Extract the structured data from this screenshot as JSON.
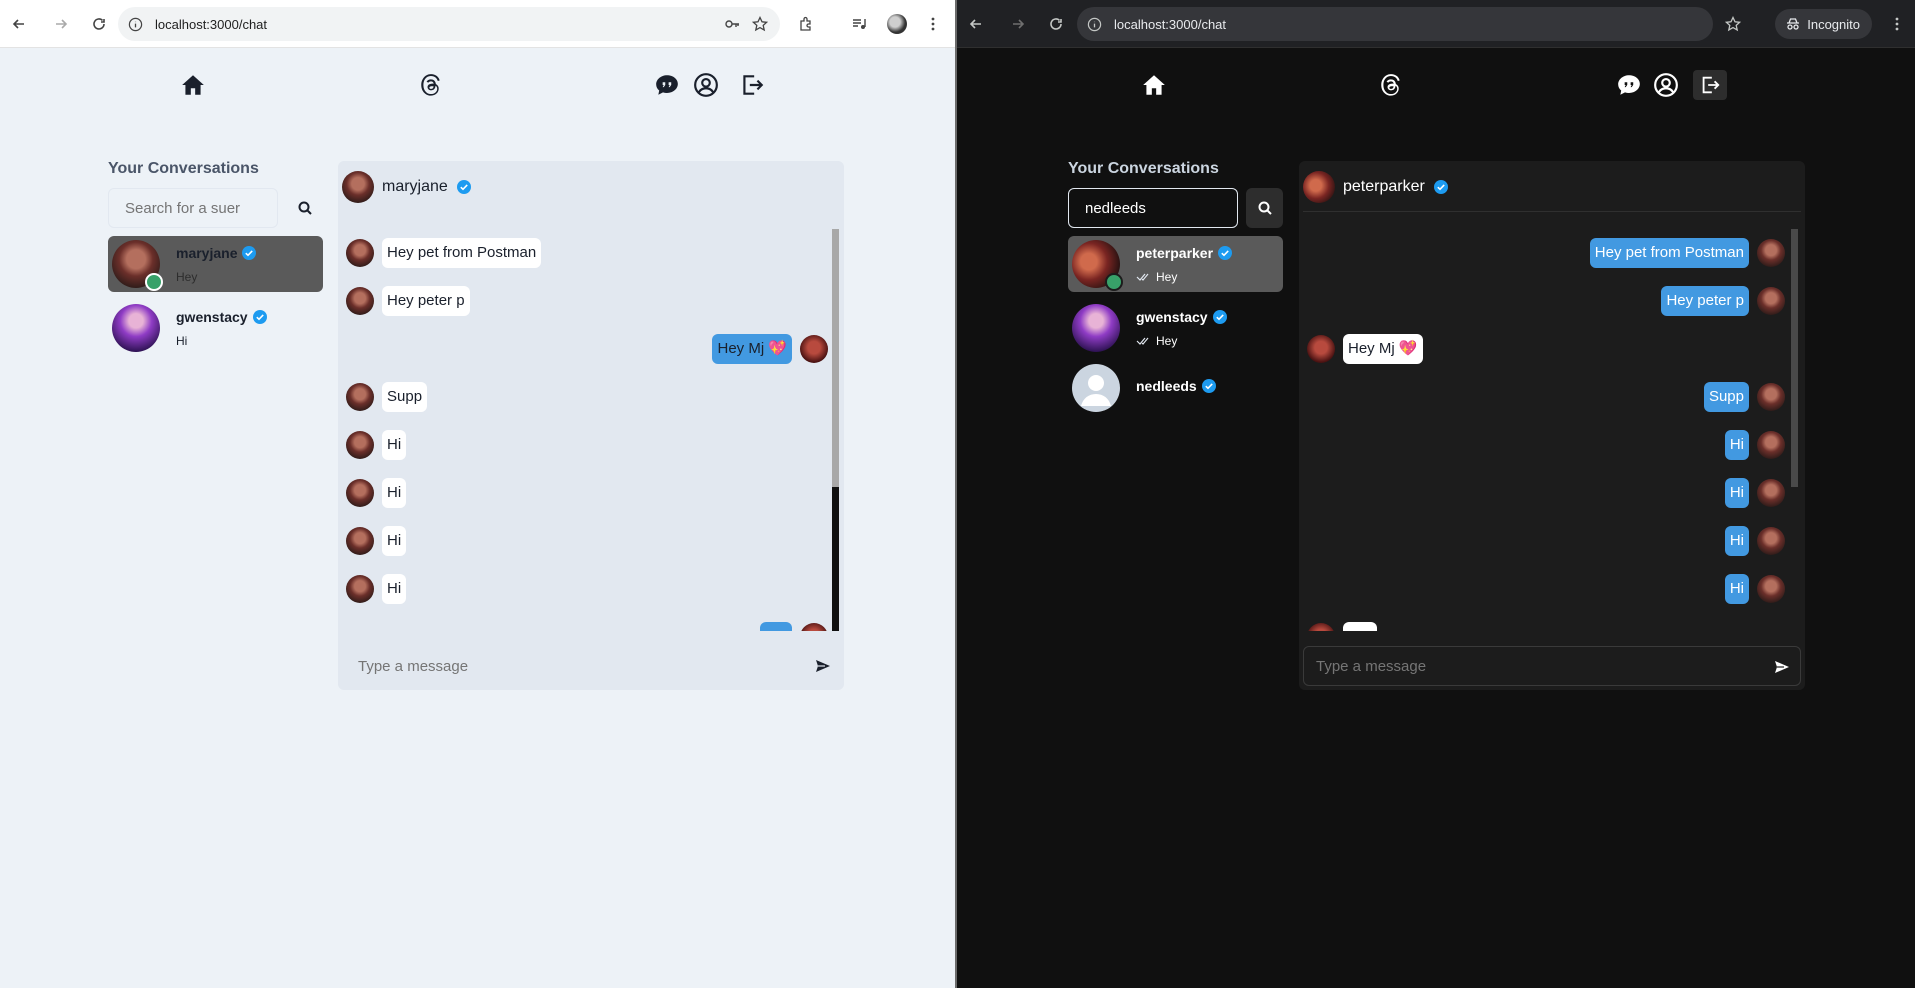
{
  "light": {
    "url": "localhost:3000/chat",
    "sidebar_title": "Your Conversations",
    "search_placeholder": "Search for a suer",
    "search_value": "",
    "conversations": [
      {
        "name": "maryjane",
        "last": "Hey",
        "online": true,
        "selected": true,
        "seen": false
      },
      {
        "name": "gwenstacy",
        "last": "Hi",
        "online": false,
        "selected": false,
        "seen": false
      }
    ],
    "chat_user": "maryjane",
    "messages": [
      {
        "text": "Hey pet from Postman",
        "mine": false
      },
      {
        "text": "Hey peter p",
        "mine": false
      },
      {
        "text": "Hey Mj 💖",
        "mine": true
      },
      {
        "text": "Supp",
        "mine": false
      },
      {
        "text": "Hi",
        "mine": false
      },
      {
        "text": "Hi",
        "mine": false
      },
      {
        "text": "Hi",
        "mine": false
      },
      {
        "text": "Hi",
        "mine": false
      },
      {
        "text": "",
        "mine": true
      }
    ],
    "input_placeholder": "Type a message"
  },
  "dark": {
    "url": "localhost:3000/chat",
    "incognito_label": "Incognito",
    "sidebar_title": "Your Conversations",
    "search_placeholder": "Search for a suer",
    "search_value": "nedleeds",
    "conversations": [
      {
        "name": "peterparker",
        "last": "Hey",
        "online": true,
        "selected": true,
        "seen": true
      },
      {
        "name": "gwenstacy",
        "last": "Hey",
        "online": false,
        "selected": false,
        "seen": true
      },
      {
        "name": "nedleeds",
        "last": "",
        "online": false,
        "selected": false,
        "seen": false
      }
    ],
    "chat_user": "peterparker",
    "messages": [
      {
        "text": "Hey pet from Postman",
        "mine": true
      },
      {
        "text": "Hey peter p",
        "mine": true
      },
      {
        "text": "Hey Mj 💖",
        "mine": false
      },
      {
        "text": "Supp",
        "mine": true
      },
      {
        "text": "Hi",
        "mine": true
      },
      {
        "text": "Hi",
        "mine": true
      },
      {
        "text": "Hi",
        "mine": true
      },
      {
        "text": "Hi",
        "mine": true
      },
      {
        "text": "",
        "mine": false
      }
    ],
    "input_placeholder": "Type a message"
  },
  "colors": {
    "accent": "#4299e1",
    "online": "#38a169",
    "verified": "#1d9bf0"
  }
}
